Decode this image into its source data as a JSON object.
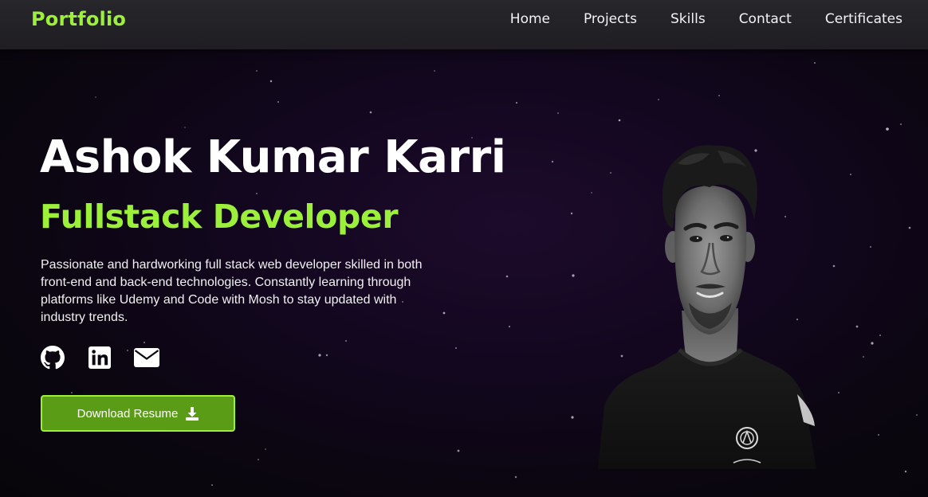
{
  "navbar": {
    "brand": "Portfolio",
    "links": [
      {
        "label": "Home"
      },
      {
        "label": "Projects"
      },
      {
        "label": "Skills"
      },
      {
        "label": "Contact"
      },
      {
        "label": "Certificates"
      }
    ]
  },
  "hero": {
    "name": "Ashok Kumar Karri",
    "role": "Fullstack Developer",
    "description": "Passionate and hardworking full stack web developer skilled in both front-end and back-end technologies. Constantly learning through platforms like Udemy and Code with Mosh to stay updated with industry trends.",
    "socials": [
      {
        "icon": "github-icon"
      },
      {
        "icon": "linkedin-icon"
      },
      {
        "icon": "email-icon"
      }
    ],
    "download_button": {
      "label": "Download Resume",
      "icon": "download-icon"
    }
  },
  "colors": {
    "accent": "#9cf03a",
    "button_bg": "#5b9c17",
    "navbar_bg": "#232227",
    "background": "#130720",
    "text": "#ffffff"
  }
}
